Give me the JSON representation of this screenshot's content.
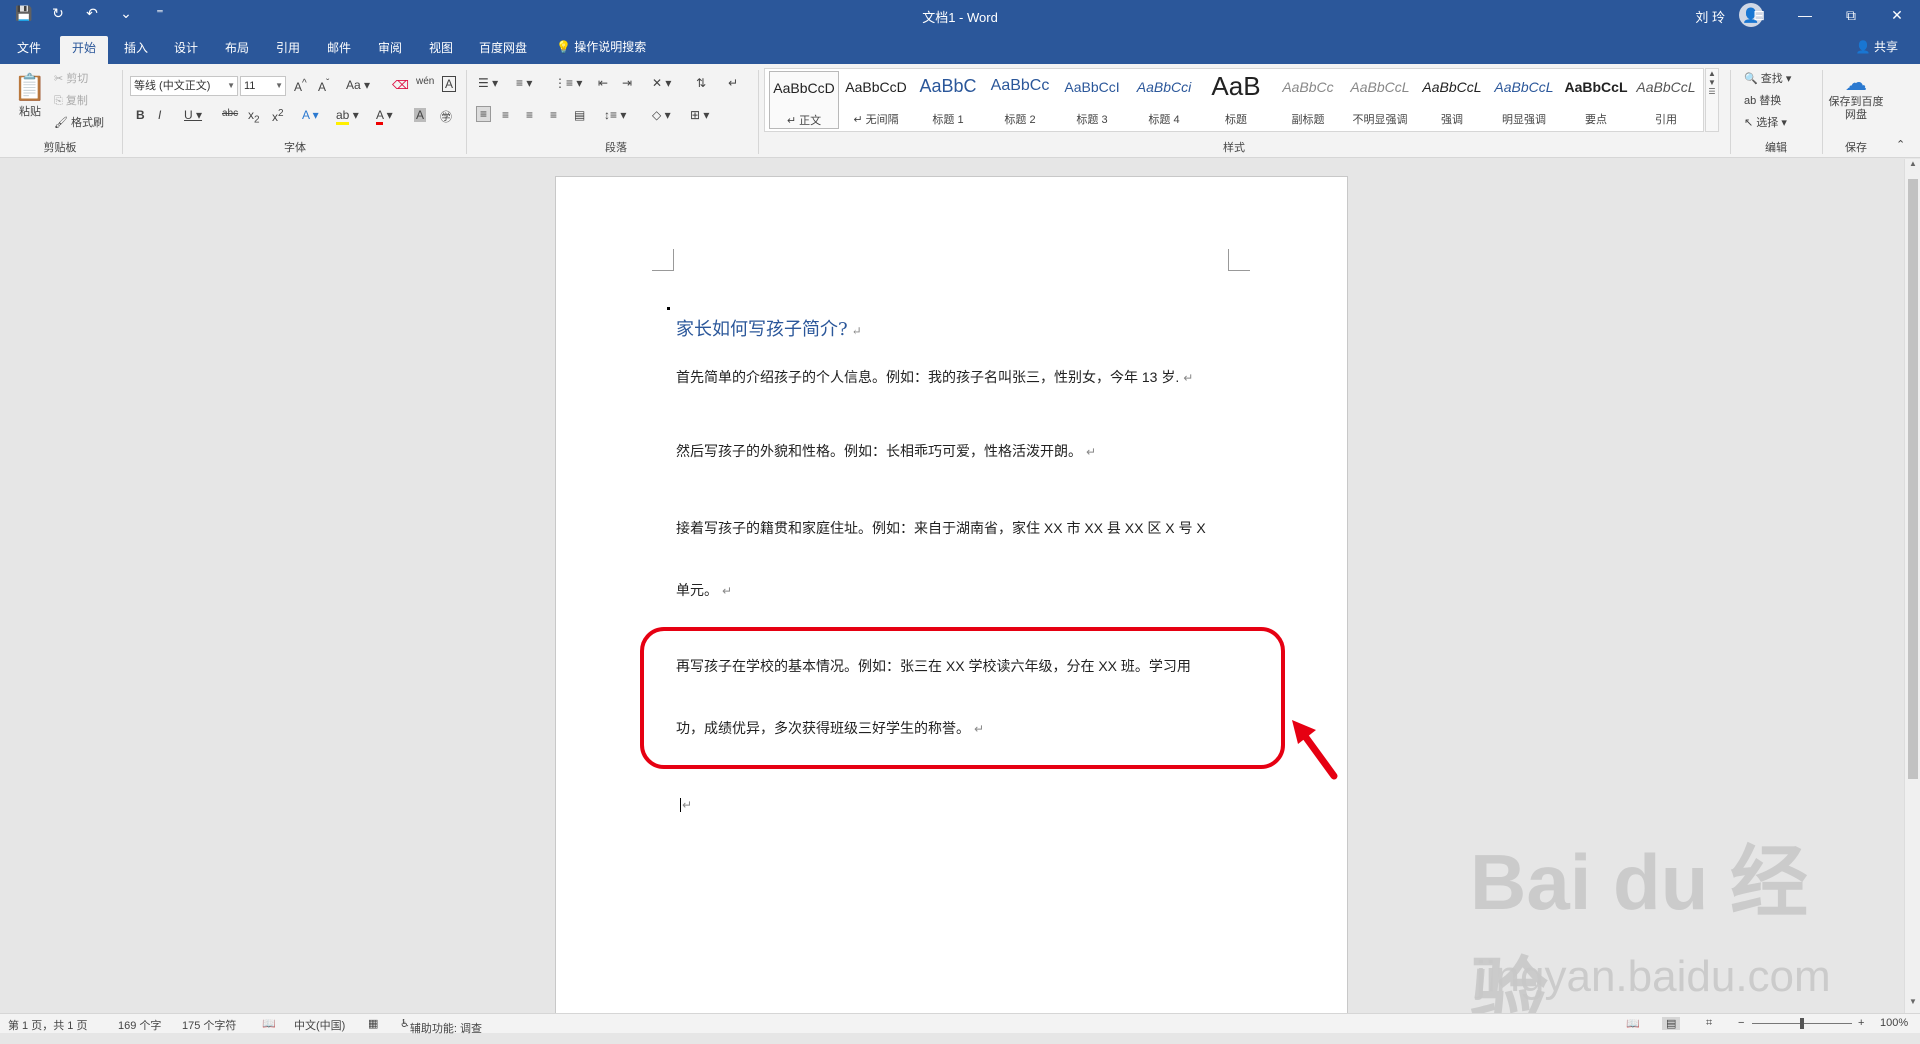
{
  "titlebar": {
    "title": "文档1 - Word",
    "user": "刘 玲",
    "qat": {
      "save_icon": "💾",
      "redo_icon": "↻",
      "undo_icon": "↶",
      "undo_dd": "⌄",
      "customize": "⁼"
    },
    "win": {
      "ribbon_display": "⊟",
      "minimize": "—",
      "restore": "⧉",
      "close": "✕"
    }
  },
  "tabs": [
    "文件",
    "开始",
    "插入",
    "设计",
    "布局",
    "引用",
    "邮件",
    "审阅",
    "视图",
    "百度网盘"
  ],
  "tab_search": "操作说明搜索",
  "share": "共享",
  "clipboard": {
    "paste": "粘贴",
    "cut": "剪切",
    "copy": "复制",
    "format_painter": "格式刷",
    "label": "剪贴板"
  },
  "font": {
    "name": "等线 (中文正文)",
    "size": "11",
    "label": "字体"
  },
  "paragraph": {
    "label": "段落"
  },
  "styles": {
    "label": "样式",
    "items": [
      {
        "sample": "AaBbCcD",
        "name": "正文"
      },
      {
        "sample": "AaBbCcD",
        "name": "无间隔"
      },
      {
        "sample": "AaBbC",
        "name": "标题 1"
      },
      {
        "sample": "AaBbCc",
        "name": "标题 2"
      },
      {
        "sample": "AaBbCcI",
        "name": "标题 3"
      },
      {
        "sample": "AaBbCci",
        "name": "标题 4"
      },
      {
        "sample": "AaB",
        "name": "标题"
      },
      {
        "sample": "AaBbCc",
        "name": "副标题"
      },
      {
        "sample": "AaBbCcL",
        "name": "不明显强调"
      },
      {
        "sample": "AaBbCcL",
        "name": "强调"
      },
      {
        "sample": "AaBbCcL",
        "name": "明显强调"
      },
      {
        "sample": "AaBbCcL",
        "name": "要点"
      },
      {
        "sample": "AaBbCcL",
        "name": "引用"
      }
    ]
  },
  "editing": {
    "find": "查找",
    "replace": "替换",
    "select": "选择",
    "label": "编辑"
  },
  "save_group": {
    "save_to_baidu": "保存到百度网盘",
    "label": "保存"
  },
  "document": {
    "heading": "家长如何写孩子简介?",
    "paragraphs": [
      "首先简单的介绍孩子的个人信息。例如：我的孩子名叫张三，性别女，今年 13 岁.",
      "然后写孩子的外貌和性格。例如：长相乖巧可爱，性格活泼开朗。",
      "接着写孩子的籍贯和家庭住址。例如：来自于湖南省，家住 XX 市 XX 县 XX 区 X 号 X",
      "单元。",
      "再写孩子在学校的基本情况。例如：张三在 XX 学校读六年级，分在 XX 班。学习用",
      "功，成绩优异，多次获得班级三好学生的称誉。"
    ],
    "para_mark": "↵"
  },
  "watermark": {
    "brand": "Bai du 经验",
    "url": "jingyan.baidu.com"
  },
  "statusbar": {
    "page": "第 1 页，共 1 页",
    "words": "169 个字",
    "chars": "175 个字符",
    "language": "中文(中国)",
    "accessibility": "辅助功能: 调查",
    "zoom": "100%"
  },
  "colors": {
    "brand": "#2b579a",
    "highlight": "#e60012"
  }
}
